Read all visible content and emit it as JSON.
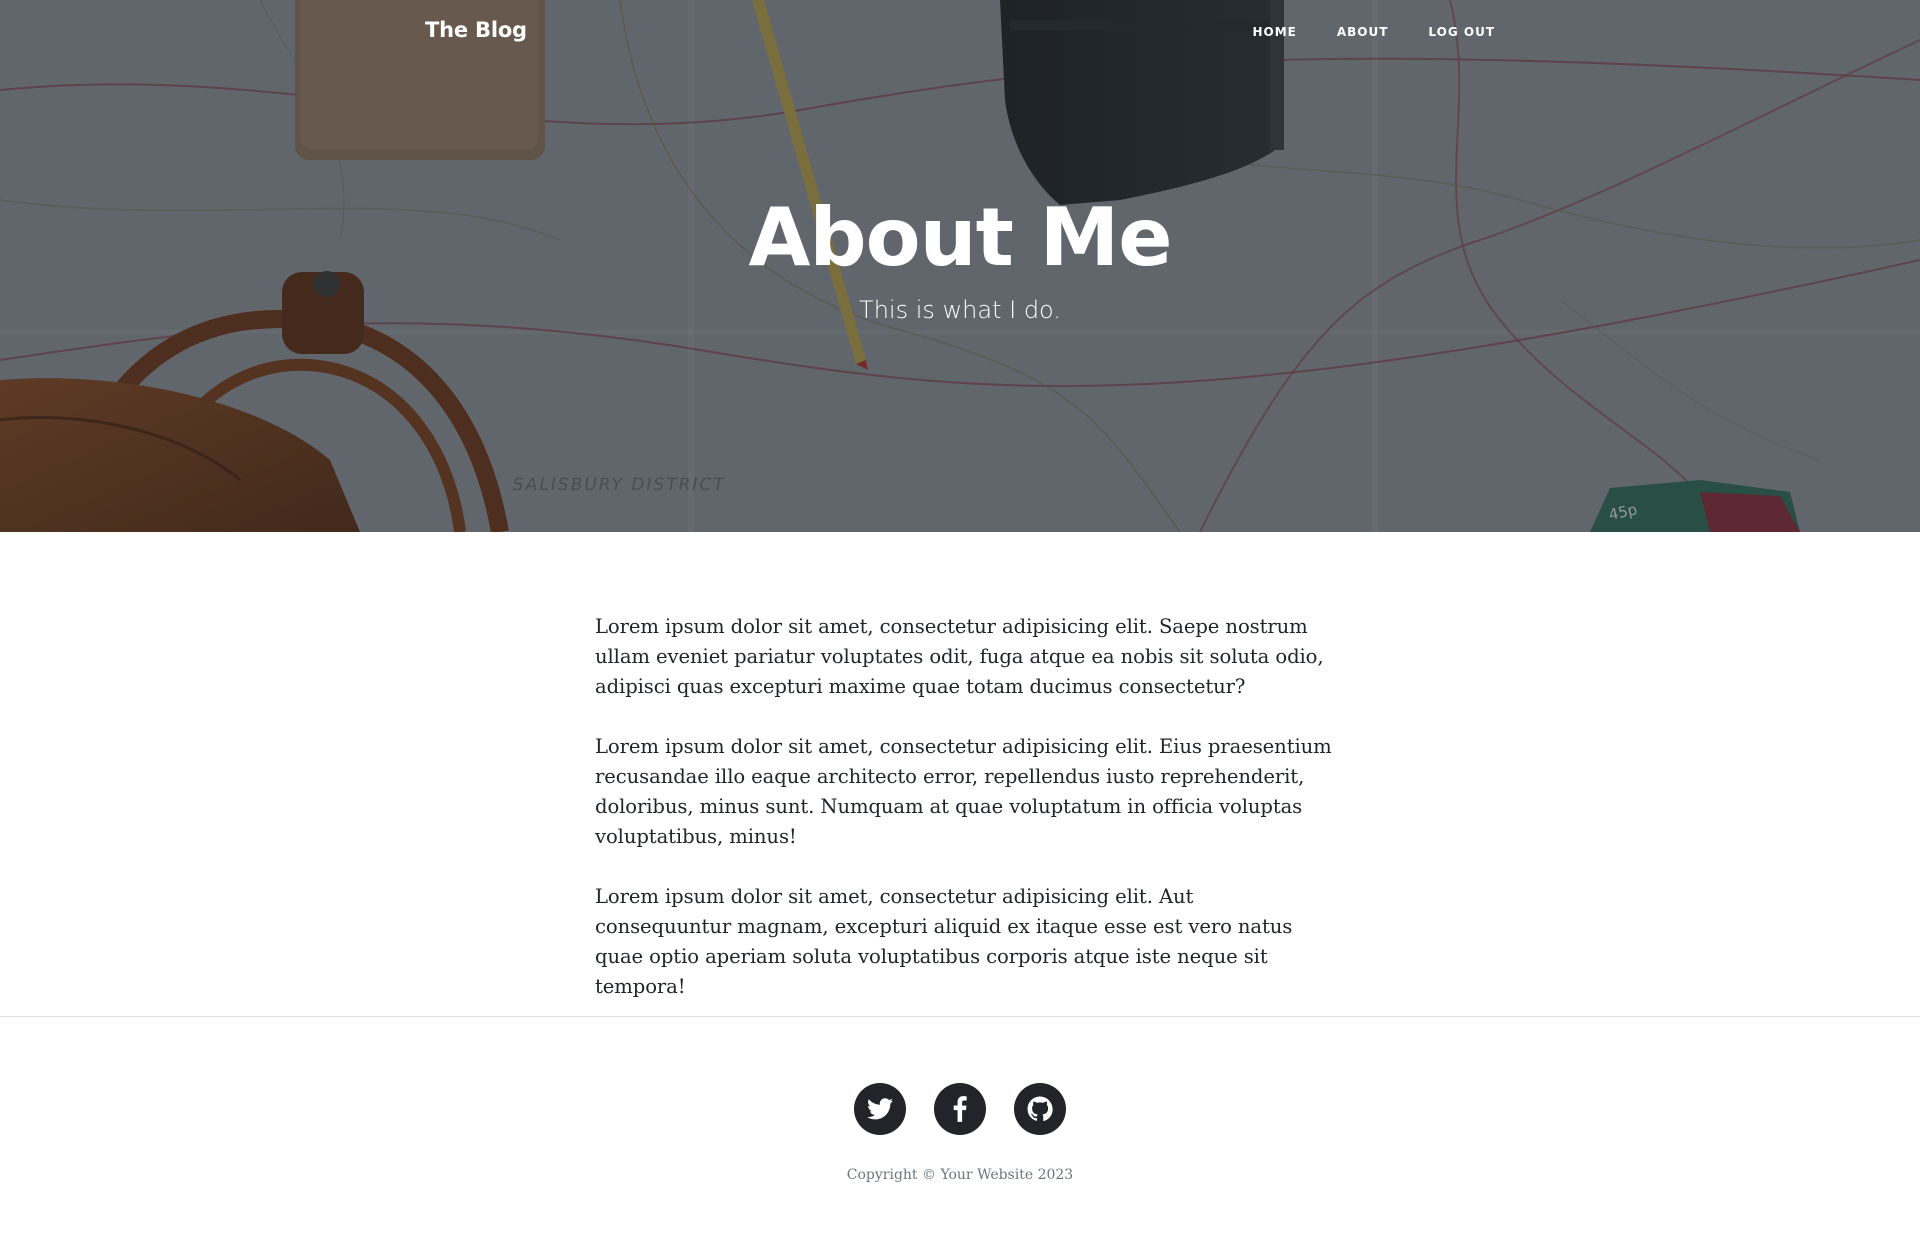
{
  "navbar": {
    "brand": "The Blog",
    "links": [
      "Home",
      "About",
      "Log Out"
    ]
  },
  "hero": {
    "title": "About Me",
    "subtitle": "This is what I do.",
    "map_text": "SALISBURY DISTRICT",
    "price_tag": "45p"
  },
  "content": {
    "paragraphs": [
      "Lorem ipsum dolor sit amet, consectetur adipisicing elit. Saepe nostrum ullam eveniet pariatur voluptates odit, fuga atque ea nobis sit soluta odio, adipisci quas excepturi maxime quae totam ducimus consectetur?",
      "Lorem ipsum dolor sit amet, consectetur adipisicing elit. Eius praesentium recusandae illo eaque architecto error, repellendus iusto reprehenderit, doloribus, minus sunt. Numquam at quae voluptatum in officia voluptas voluptatibus, minus!",
      "Lorem ipsum dolor sit amet, consectetur adipisicing elit. Aut consequuntur magnam, excepturi aliquid ex itaque esse est vero natus quae optio aperiam soluta voluptatibus corporis atque iste neque sit tempora!"
    ]
  },
  "footer": {
    "social": [
      {
        "name": "twitter-icon"
      },
      {
        "name": "facebook-icon"
      },
      {
        "name": "github-icon"
      }
    ],
    "copyright": "Copyright © Your Website 2023"
  },
  "colors": {
    "text": "#212529",
    "muted": "#6c757d",
    "icon_bg": "#212529",
    "white": "#ffffff"
  }
}
